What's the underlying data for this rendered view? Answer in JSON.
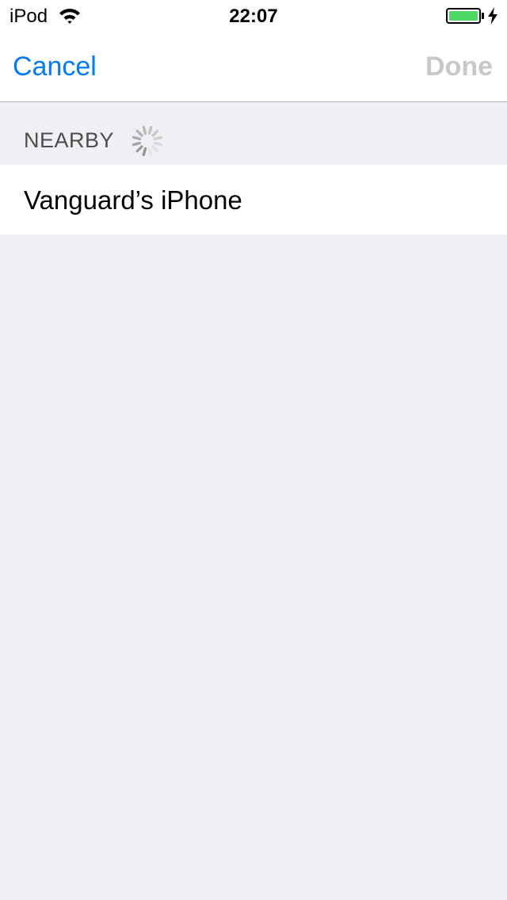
{
  "status_bar": {
    "carrier": "iPod",
    "time": "22:07",
    "battery_level": 1.0,
    "charging": true,
    "battery_color": "#4cd964",
    "icons": [
      "wifi-icon",
      "battery-icon",
      "charging-bolt-icon"
    ]
  },
  "navbar": {
    "cancel_label": "Cancel",
    "done_label": "Done",
    "cancel_color": "#007aff",
    "done_color": "#c7c7cc",
    "done_enabled": false
  },
  "section": {
    "title": "NEARBY",
    "loading": true,
    "icon": "activity-spinner-icon"
  },
  "devices": [
    {
      "name": "Vanguard’s iPhone"
    }
  ]
}
